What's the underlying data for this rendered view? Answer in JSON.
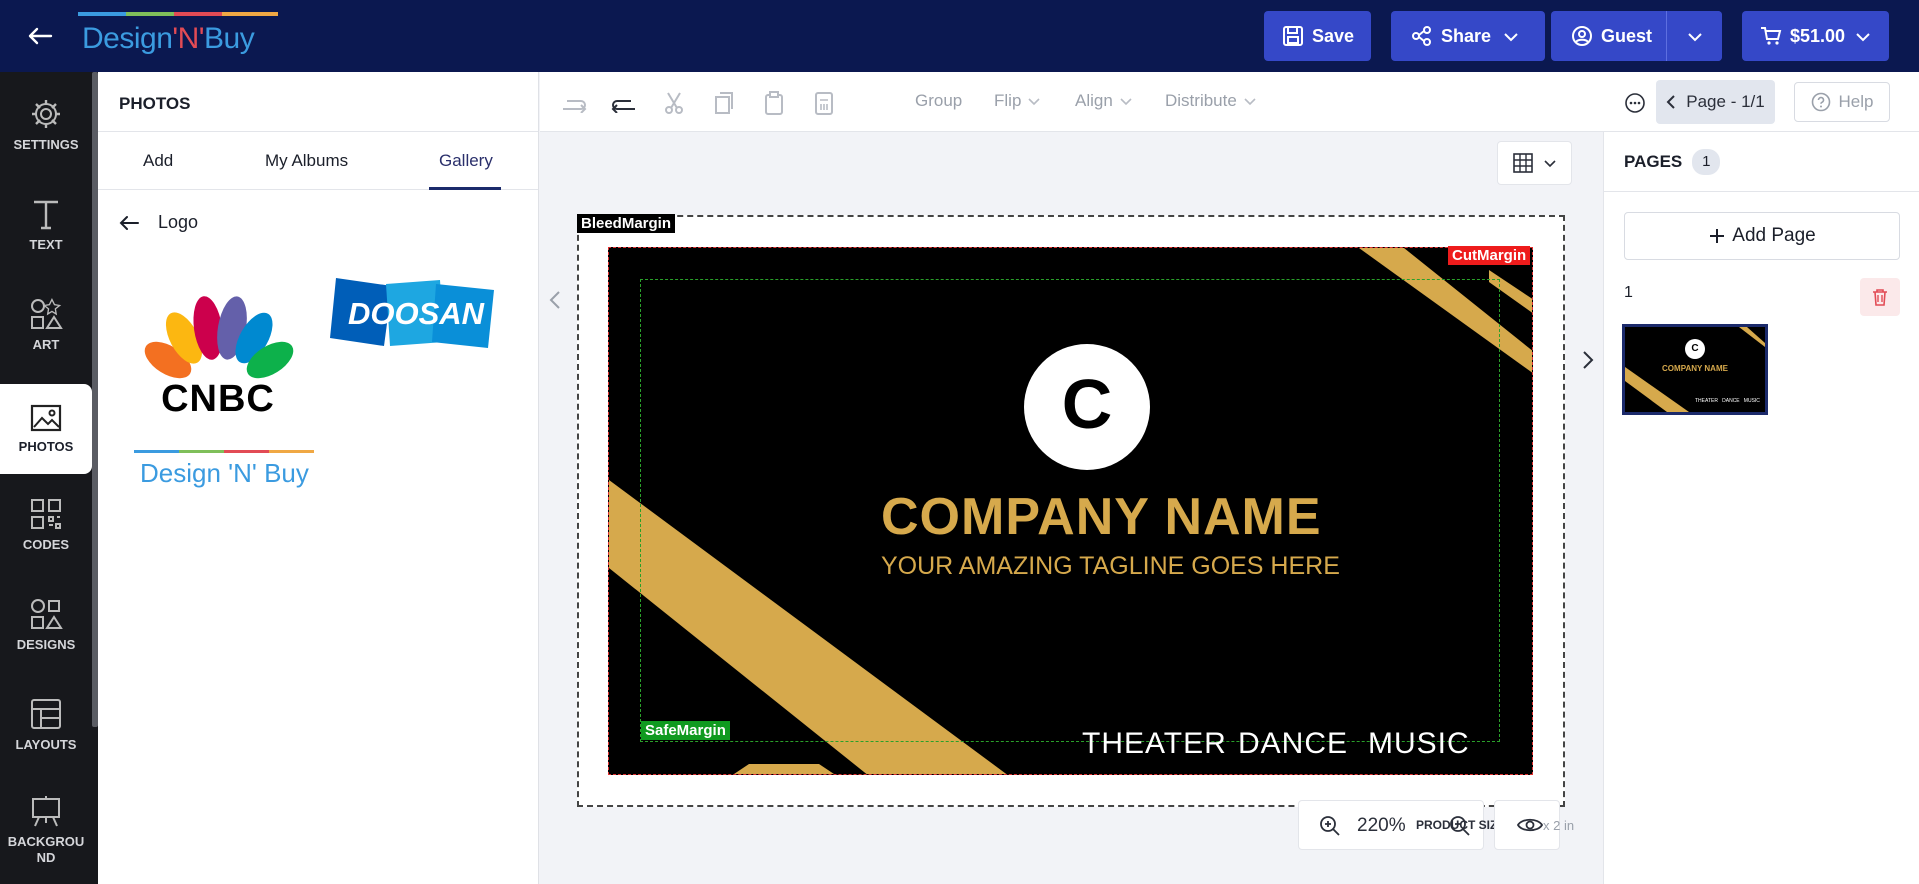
{
  "header": {
    "logo_text_1": "Design",
    "logo_text_2": "'N'",
    "logo_text_3": "Buy",
    "save_label": "Save",
    "share_label": "Share",
    "user_label": "Guest",
    "cart_label": "$51.00"
  },
  "leftnav": {
    "items": [
      {
        "label": "SETTINGS",
        "icon": "gear-icon"
      },
      {
        "label": "TEXT",
        "icon": "text-icon"
      },
      {
        "label": "ART",
        "icon": "shapes-icon"
      },
      {
        "label": "PHOTOS",
        "icon": "image-icon"
      },
      {
        "label": "CODES",
        "icon": "qr-code-icon"
      },
      {
        "label": "DESIGNS",
        "icon": "designs-icon"
      },
      {
        "label": "LAYOUTS",
        "icon": "layout-icon"
      },
      {
        "label": "BACKGROU ND",
        "icon": "easel-icon"
      }
    ],
    "active": "PHOTOS"
  },
  "photos_panel": {
    "title": "PHOTOS",
    "tabs": [
      "Add",
      "My Albums",
      "Gallery"
    ],
    "active_tab": "Gallery",
    "breadcrumb": "Logo",
    "thumbnails": [
      "CNBC",
      "DOOSAN",
      "Design 'N' Buy"
    ],
    "cnbc_text": "CNBC",
    "doosan_text": "DOOSAN",
    "dnb_text": "Design 'N' Buy"
  },
  "toolbar": {
    "group_label": "Group",
    "flip_label": "Flip",
    "align_label": "Align",
    "distribute_label": "Distribute",
    "page_label": "Page - 1/1",
    "help_label": "Help"
  },
  "canvas": {
    "bleed_label": "BleedMargin",
    "cut_label": "CutMargin",
    "safe_label": "SafeMargin",
    "logo_letter": "C",
    "company_name": "COMPANY NAME",
    "tagline": "YOUR AMAZING TAGLINE GOES HERE",
    "bottom_words": [
      "THEATER",
      "DANCE",
      "MUSIC"
    ],
    "zoom": "220%",
    "product_size_label": "PRODUCT SIZE",
    "product_size_value": "x 2 in",
    "accent_gold": "#d6a94c"
  },
  "pages_panel": {
    "title": "PAGES",
    "count": "1",
    "add_label": "Add Page",
    "page_number": "1",
    "thumb_company": "COMPANY NAME",
    "thumb_bottom": "THEATER   DANCE   MUSIC"
  }
}
